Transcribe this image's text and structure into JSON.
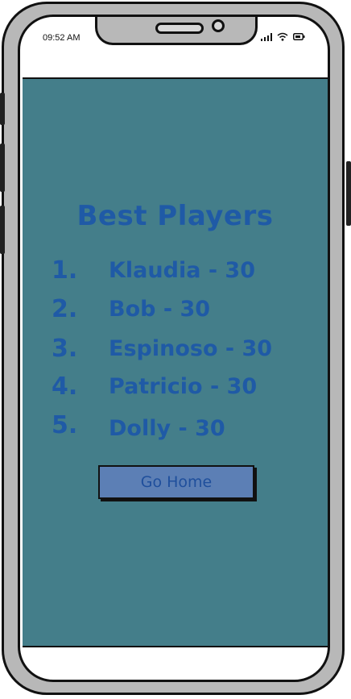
{
  "status_bar": {
    "time": "09:52 AM",
    "icons": [
      "signal-icon",
      "wifi-icon",
      "battery-icon"
    ]
  },
  "screen": {
    "title": "Best Players",
    "players": [
      {
        "rank": "1.",
        "entry": "Klaudia - 30"
      },
      {
        "rank": "2.",
        "entry": "Bob - 30"
      },
      {
        "rank": "3.",
        "entry": "Espinoso - 30"
      },
      {
        "rank": "4.",
        "entry": "Patricio - 30"
      },
      {
        "rank": "5.",
        "entry": "Dolly - 30"
      }
    ],
    "button_label": "Go Home"
  },
  "colors": {
    "background": "#447e8a",
    "text": "#1f5aa6",
    "button": "#5c7fb5",
    "frame": "#b8b8b8"
  }
}
